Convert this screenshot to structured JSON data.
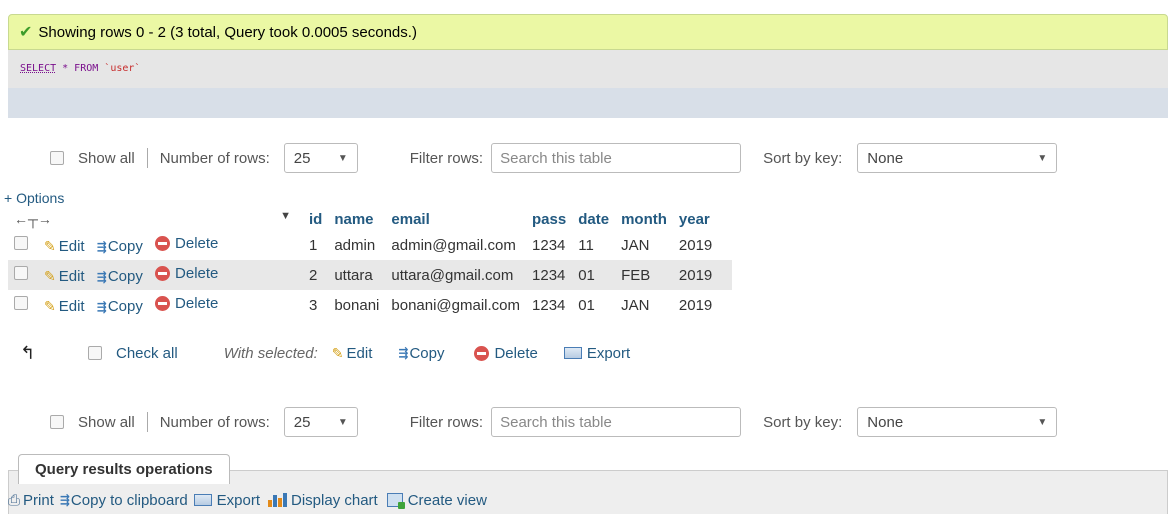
{
  "message": {
    "text": "Showing rows 0 - 2 (3 total, Query took 0.0005 seconds.)"
  },
  "sql": {
    "keyword": "SELECT",
    "rest": " * FROM ",
    "table": "`user`"
  },
  "nav": {
    "show_all": "Show all",
    "number_of_rows_label": "Number of rows:",
    "number_of_rows_value": "25",
    "filter_label": "Filter rows:",
    "filter_placeholder": "Search this table",
    "sort_label": "Sort by key:",
    "sort_value": "None"
  },
  "options_link": "+ Options",
  "columns": [
    "id",
    "name",
    "email",
    "pass",
    "date",
    "month",
    "year"
  ],
  "row_actions": {
    "edit": "Edit",
    "copy": "Copy",
    "delete": "Delete"
  },
  "rows": [
    [
      "1",
      "admin",
      "admin@gmail.com",
      "1234",
      "11",
      "JAN",
      "2019"
    ],
    [
      "2",
      "uttara",
      "uttara@gmail.com",
      "1234",
      "01",
      "FEB",
      "2019"
    ],
    [
      "3",
      "bonani",
      "bonani@gmail.com",
      "1234",
      "01",
      "JAN",
      "2019"
    ]
  ],
  "bulk": {
    "check_all": "Check all",
    "with_selected": "With selected:",
    "edit": "Edit",
    "copy": "Copy",
    "delete": "Delete",
    "export": "Export"
  },
  "query_ops": {
    "title": "Query results operations",
    "print": "Print",
    "copy_clipboard": "Copy to clipboard",
    "export": "Export",
    "display_chart": "Display chart",
    "create_view": "Create view"
  }
}
